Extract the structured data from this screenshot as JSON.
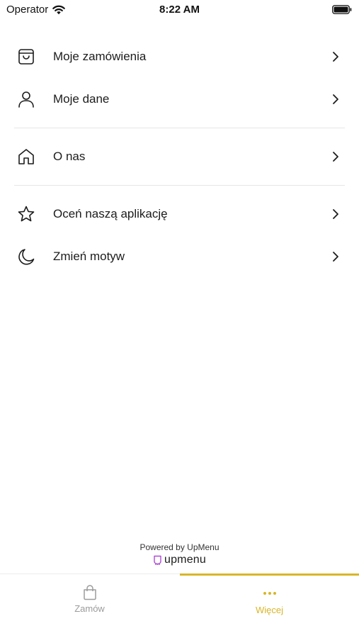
{
  "status_bar": {
    "carrier": "Operator",
    "time": "8:22 AM"
  },
  "menu": {
    "items": [
      {
        "label": "Moje zamówienia",
        "icon": "basket-icon"
      },
      {
        "label": "Moje dane",
        "icon": "user-icon"
      },
      {
        "label": "O nas",
        "icon": "home-icon"
      },
      {
        "label": "Oceń naszą aplikację",
        "icon": "star-icon"
      },
      {
        "label": "Zmień motyw",
        "icon": "moon-icon"
      }
    ]
  },
  "footer": {
    "powered_by": "Powered by UpMenu",
    "brand": "upmenu"
  },
  "tab_bar": {
    "tabs": [
      {
        "label": "Zamów",
        "icon": "shopping-bag-icon",
        "active": false
      },
      {
        "label": "Więcej",
        "icon": "more-dots-icon",
        "active": true
      }
    ]
  },
  "colors": {
    "accent": "#d8b628",
    "brand_purple": "#b04ad6",
    "inactive": "#9b9b9b"
  }
}
